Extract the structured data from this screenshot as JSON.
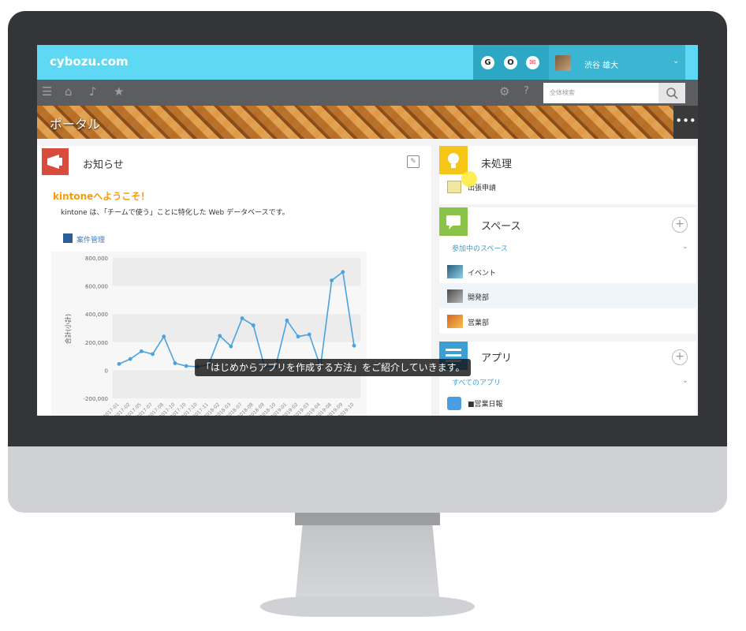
{
  "header": {
    "logo": "cybozu.com",
    "badges": [
      "G",
      "O",
      "✉"
    ],
    "user_name": "渋谷 雄大",
    "search_placeholder": "全体検索"
  },
  "banner": {
    "title": "ポータル"
  },
  "notice": {
    "title": "お知らせ",
    "heading": "kintoneへようこそ！",
    "body": "kintone は、「チームで使う」ことに特化した Web データベースです。",
    "app_link": "案件管理"
  },
  "pending": {
    "title": "未処理",
    "items": [
      "出張申請"
    ]
  },
  "spaces": {
    "title": "スペース",
    "subheader": "参加中のスペース",
    "items": [
      "イベント",
      "開発部",
      "営業部"
    ]
  },
  "apps": {
    "title": "アプリ",
    "subheader": "すべてのアプリ",
    "items": [
      "■営業日報"
    ]
  },
  "caption": "「はじめからアプリを作成する方法」をご紹介していきます。",
  "chart_data": {
    "type": "line",
    "ylabel": "合計(小計)",
    "ylim": [
      -200000,
      800000
    ],
    "yticks": [
      "800,000",
      "600,000",
      "400,000",
      "200,000",
      "0",
      "-200,000"
    ],
    "categories": [
      "2017-01",
      "2017-02",
      "2017-05",
      "2017-07",
      "2017-08",
      "2017-10",
      "2017-10",
      "2017-10",
      "2017-11",
      "2018-02",
      "2018-03",
      "2018-07",
      "2018-08",
      "2018-09",
      "2018-10",
      "2019-01",
      "2019-02",
      "2019-03",
      "2019-04",
      "2019-08",
      "2019-09",
      "2019-10"
    ],
    "values": [
      45000,
      80000,
      135000,
      115000,
      240000,
      50000,
      30000,
      25000,
      40000,
      245000,
      170000,
      370000,
      320000,
      25000,
      30000,
      355000,
      240000,
      255000,
      25000,
      640000,
      700000,
      175000
    ],
    "color": "#4aa3df",
    "grid": true
  }
}
